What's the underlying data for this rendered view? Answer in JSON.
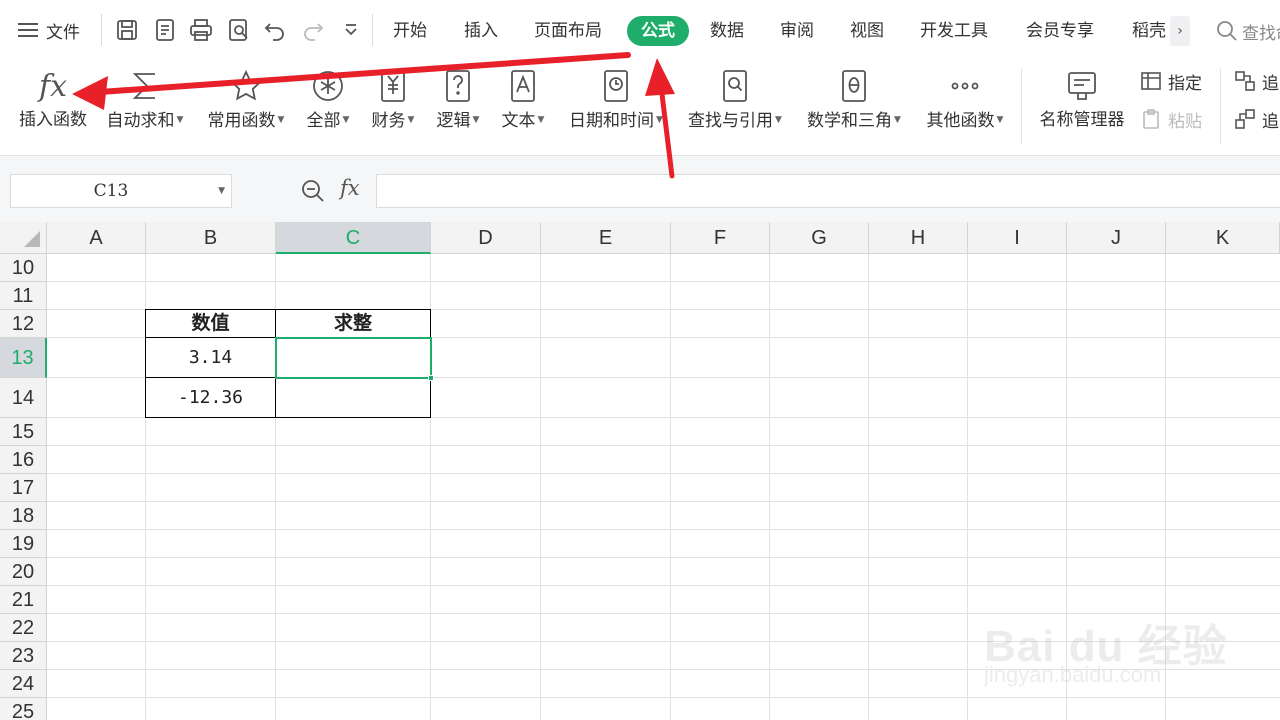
{
  "menubar": {
    "file_label": "文件",
    "tabs": [
      {
        "label": "开始"
      },
      {
        "label": "插入"
      },
      {
        "label": "页面布局"
      },
      {
        "label": "公式"
      },
      {
        "label": "数据"
      },
      {
        "label": "审阅"
      },
      {
        "label": "视图"
      },
      {
        "label": "开发工具"
      },
      {
        "label": "会员专享"
      },
      {
        "label": "稻壳"
      }
    ],
    "active_tab": "公式",
    "search_label": "查找命"
  },
  "ribbon": {
    "insert_function": "插入函数",
    "auto_sum": "自动求和",
    "common_functions": "常用函数",
    "all": "全部",
    "financial": "财务",
    "logical": "逻辑",
    "text": "文本",
    "date_time": "日期和时间",
    "lookup_reference": "查找与引用",
    "math_trig": "数学和三角",
    "other_functions": "其他函数",
    "name_manager": "名称管理器",
    "specify": "指定",
    "paste": "粘贴",
    "trace_top": "追",
    "trace_bottom": "追",
    "fx_glyph": "fx"
  },
  "formula_bar": {
    "name_box": "C13",
    "fx_label": "fx",
    "formula": ""
  },
  "grid": {
    "columns": [
      "A",
      "B",
      "C",
      "D",
      "E",
      "F",
      "G",
      "H",
      "I",
      "J",
      "K"
    ],
    "rows": [
      "10",
      "11",
      "12",
      "13",
      "14",
      "15",
      "16",
      "17",
      "18",
      "19",
      "20",
      "21",
      "22",
      "23",
      "24",
      "25"
    ],
    "active_cell": "C13"
  },
  "table": {
    "header_value": "数值",
    "header_round": "求整",
    "row1_value": "3.14",
    "row2_value": "-12.36",
    "row1_round": "",
    "row2_round": ""
  },
  "watermark": {
    "main": "Bai du 经验",
    "sub": "jingyan.baidu.com"
  },
  "colors": {
    "accent": "#1fad6b",
    "annotation": "#e8202a"
  }
}
